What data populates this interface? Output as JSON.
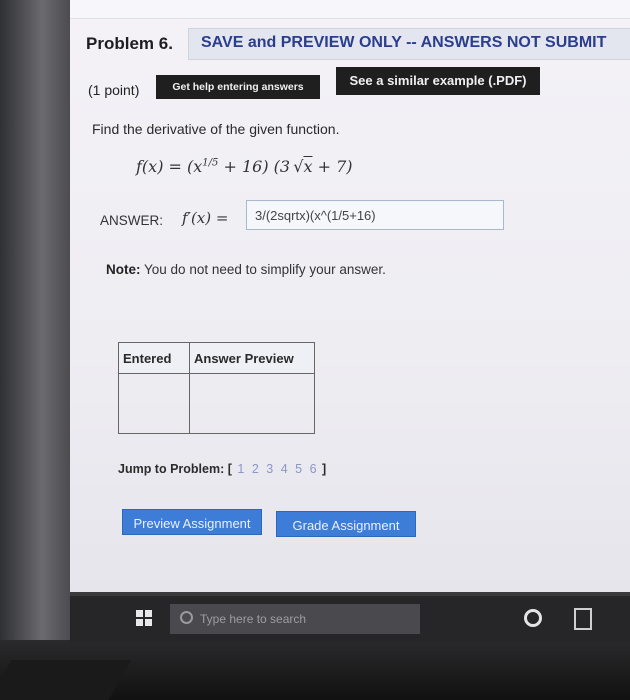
{
  "problem": {
    "title": "Problem 6.",
    "banner": "SAVE and PREVIEW ONLY -- ANSWERS NOT SUBMIT",
    "points": "(1 point)",
    "help_button": "Get help entering answers",
    "example_button": "See a similar example (.PDF)",
    "question": "Find the derivative of the given function.",
    "formula": "f(x) = (x^{1/5} + 16)(3√x + 7)",
    "answer_label": "ANSWER:",
    "answer_function": "f′(x) =",
    "answer_value": "3/(2sqrtx)(x^(1/5+16)",
    "note_label": "Note:",
    "note_text": "You do not need to simplify your answer."
  },
  "preview_table": {
    "headers": [
      "Entered",
      "Answer Preview"
    ]
  },
  "jump": {
    "label": "Jump to Problem: [",
    "problems": [
      "1",
      "2",
      "3",
      "4",
      "5",
      "6"
    ],
    "close": "]"
  },
  "buttons": {
    "preview": "Preview Assignment",
    "grade": "Grade Assignment"
  },
  "taskbar": {
    "search_placeholder": "Type here to search"
  }
}
